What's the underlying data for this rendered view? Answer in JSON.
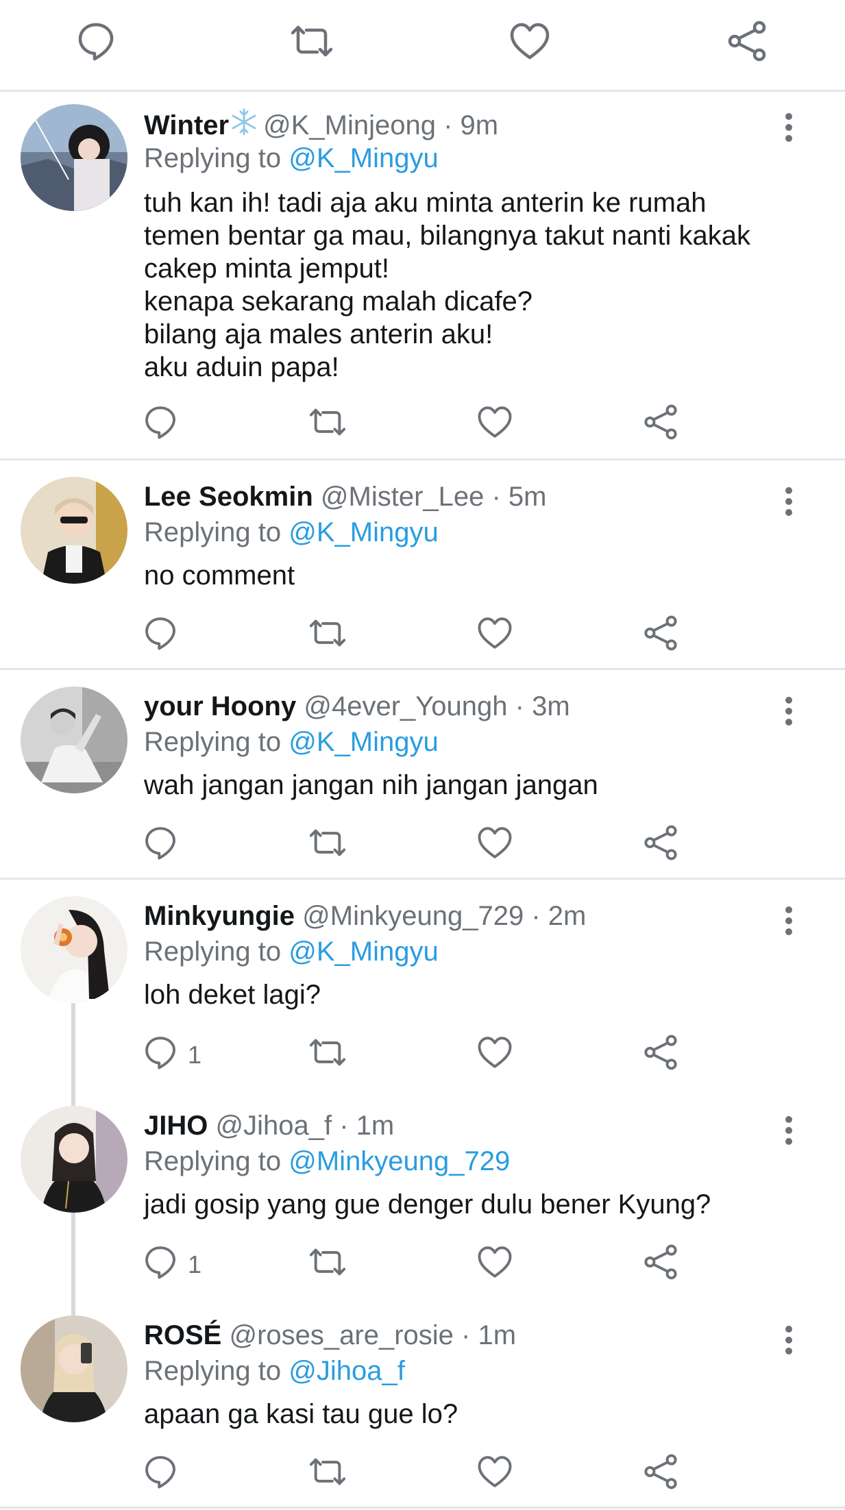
{
  "top_actions": {
    "icons": [
      "comment-icon",
      "retweet-icon",
      "like-icon",
      "share-icon"
    ]
  },
  "colors": {
    "link": "#2a9ce0",
    "muted": "#6b7177",
    "text": "#14171a",
    "divider": "#e3e6e8",
    "icon": "#6b7177"
  },
  "tweets": [
    {
      "name": "Winter",
      "handle": "@K_Minjeong",
      "time": "· 9m",
      "reply_prefix": "Replying to",
      "reply_to": "@K_Mingyu",
      "text": [
        "tuh kan ih! tadi aja aku minta anterin ke rumah",
        "temen bentar ga mau, bilangnya takut nanti kakak",
        "cakep minta jemput!",
        "kenapa sekarang malah dicafe?",
        "bilang aja males anterin aku!",
        "aku aduin papa!"
      ],
      "reply_count": ""
    },
    {
      "name": "Lee Seokmin",
      "handle": "@Mister_Lee",
      "time": "· 5m",
      "reply_prefix": "Replying to",
      "reply_to": "@K_Mingyu",
      "text": [
        "no comment"
      ],
      "reply_count": ""
    },
    {
      "name": "your Hoony",
      "handle": "@4ever_Youngh",
      "time": "· 3m",
      "reply_prefix": "Replying to",
      "reply_to": "@K_Mingyu",
      "text": [
        "wah jangan jangan nih jangan jangan"
      ],
      "reply_count": ""
    },
    {
      "name": "Minkyungie",
      "handle": "@Minkyeung_729",
      "time": "· 2m",
      "reply_prefix": "Replying to",
      "reply_to": "@K_Mingyu",
      "text": [
        "loh deket lagi?"
      ],
      "reply_count": "1"
    },
    {
      "name": "JIHO",
      "handle": "@Jihoa_f",
      "time": "· 1m",
      "reply_prefix": "Replying to",
      "reply_to": "@Minkyeung_729",
      "text": [
        "jadi gosip yang gue denger dulu bener Kyung?"
      ],
      "reply_count": "1"
    },
    {
      "name": "ROSÉ",
      "handle": "@roses_are_rosie",
      "time": "· 1m",
      "reply_prefix": "Replying to",
      "reply_to": "@Jihoa_f",
      "text": [
        "apaan ga kasi tau gue lo?"
      ],
      "reply_count": ""
    }
  ]
}
